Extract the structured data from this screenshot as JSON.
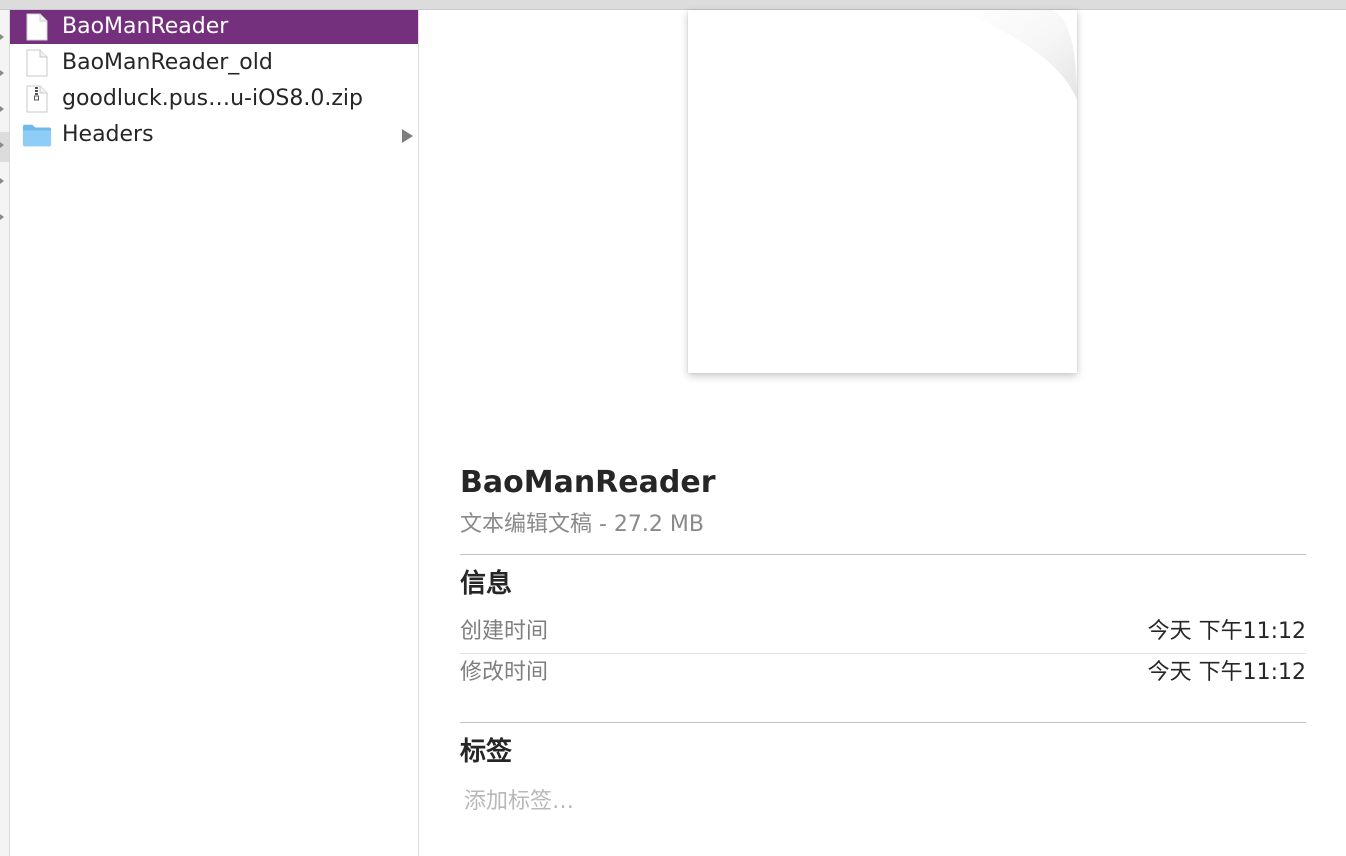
{
  "file_list": [
    {
      "name": "BaoManReader",
      "kind": "document",
      "selected": true,
      "has_children": false
    },
    {
      "name": "BaoManReader_old",
      "kind": "document",
      "selected": false,
      "has_children": false
    },
    {
      "name": "goodluck.pus…u-iOS8.0.zip",
      "kind": "zip",
      "selected": false,
      "has_children": false
    },
    {
      "name": "Headers",
      "kind": "folder",
      "selected": false,
      "has_children": true
    }
  ],
  "preview": {
    "title": "BaoManReader",
    "subtitle": "文本编辑文稿 - 27.2 MB"
  },
  "info_section": {
    "title": "信息",
    "rows": [
      {
        "label": "创建时间",
        "value": "今天 下午11:12"
      },
      {
        "label": "修改时间",
        "value": "今天 下午11:12"
      }
    ]
  },
  "tags_section": {
    "title": "标签",
    "placeholder": "添加标签…"
  },
  "colors": {
    "selection": "#74307c",
    "folder": "#8ecdf5"
  }
}
